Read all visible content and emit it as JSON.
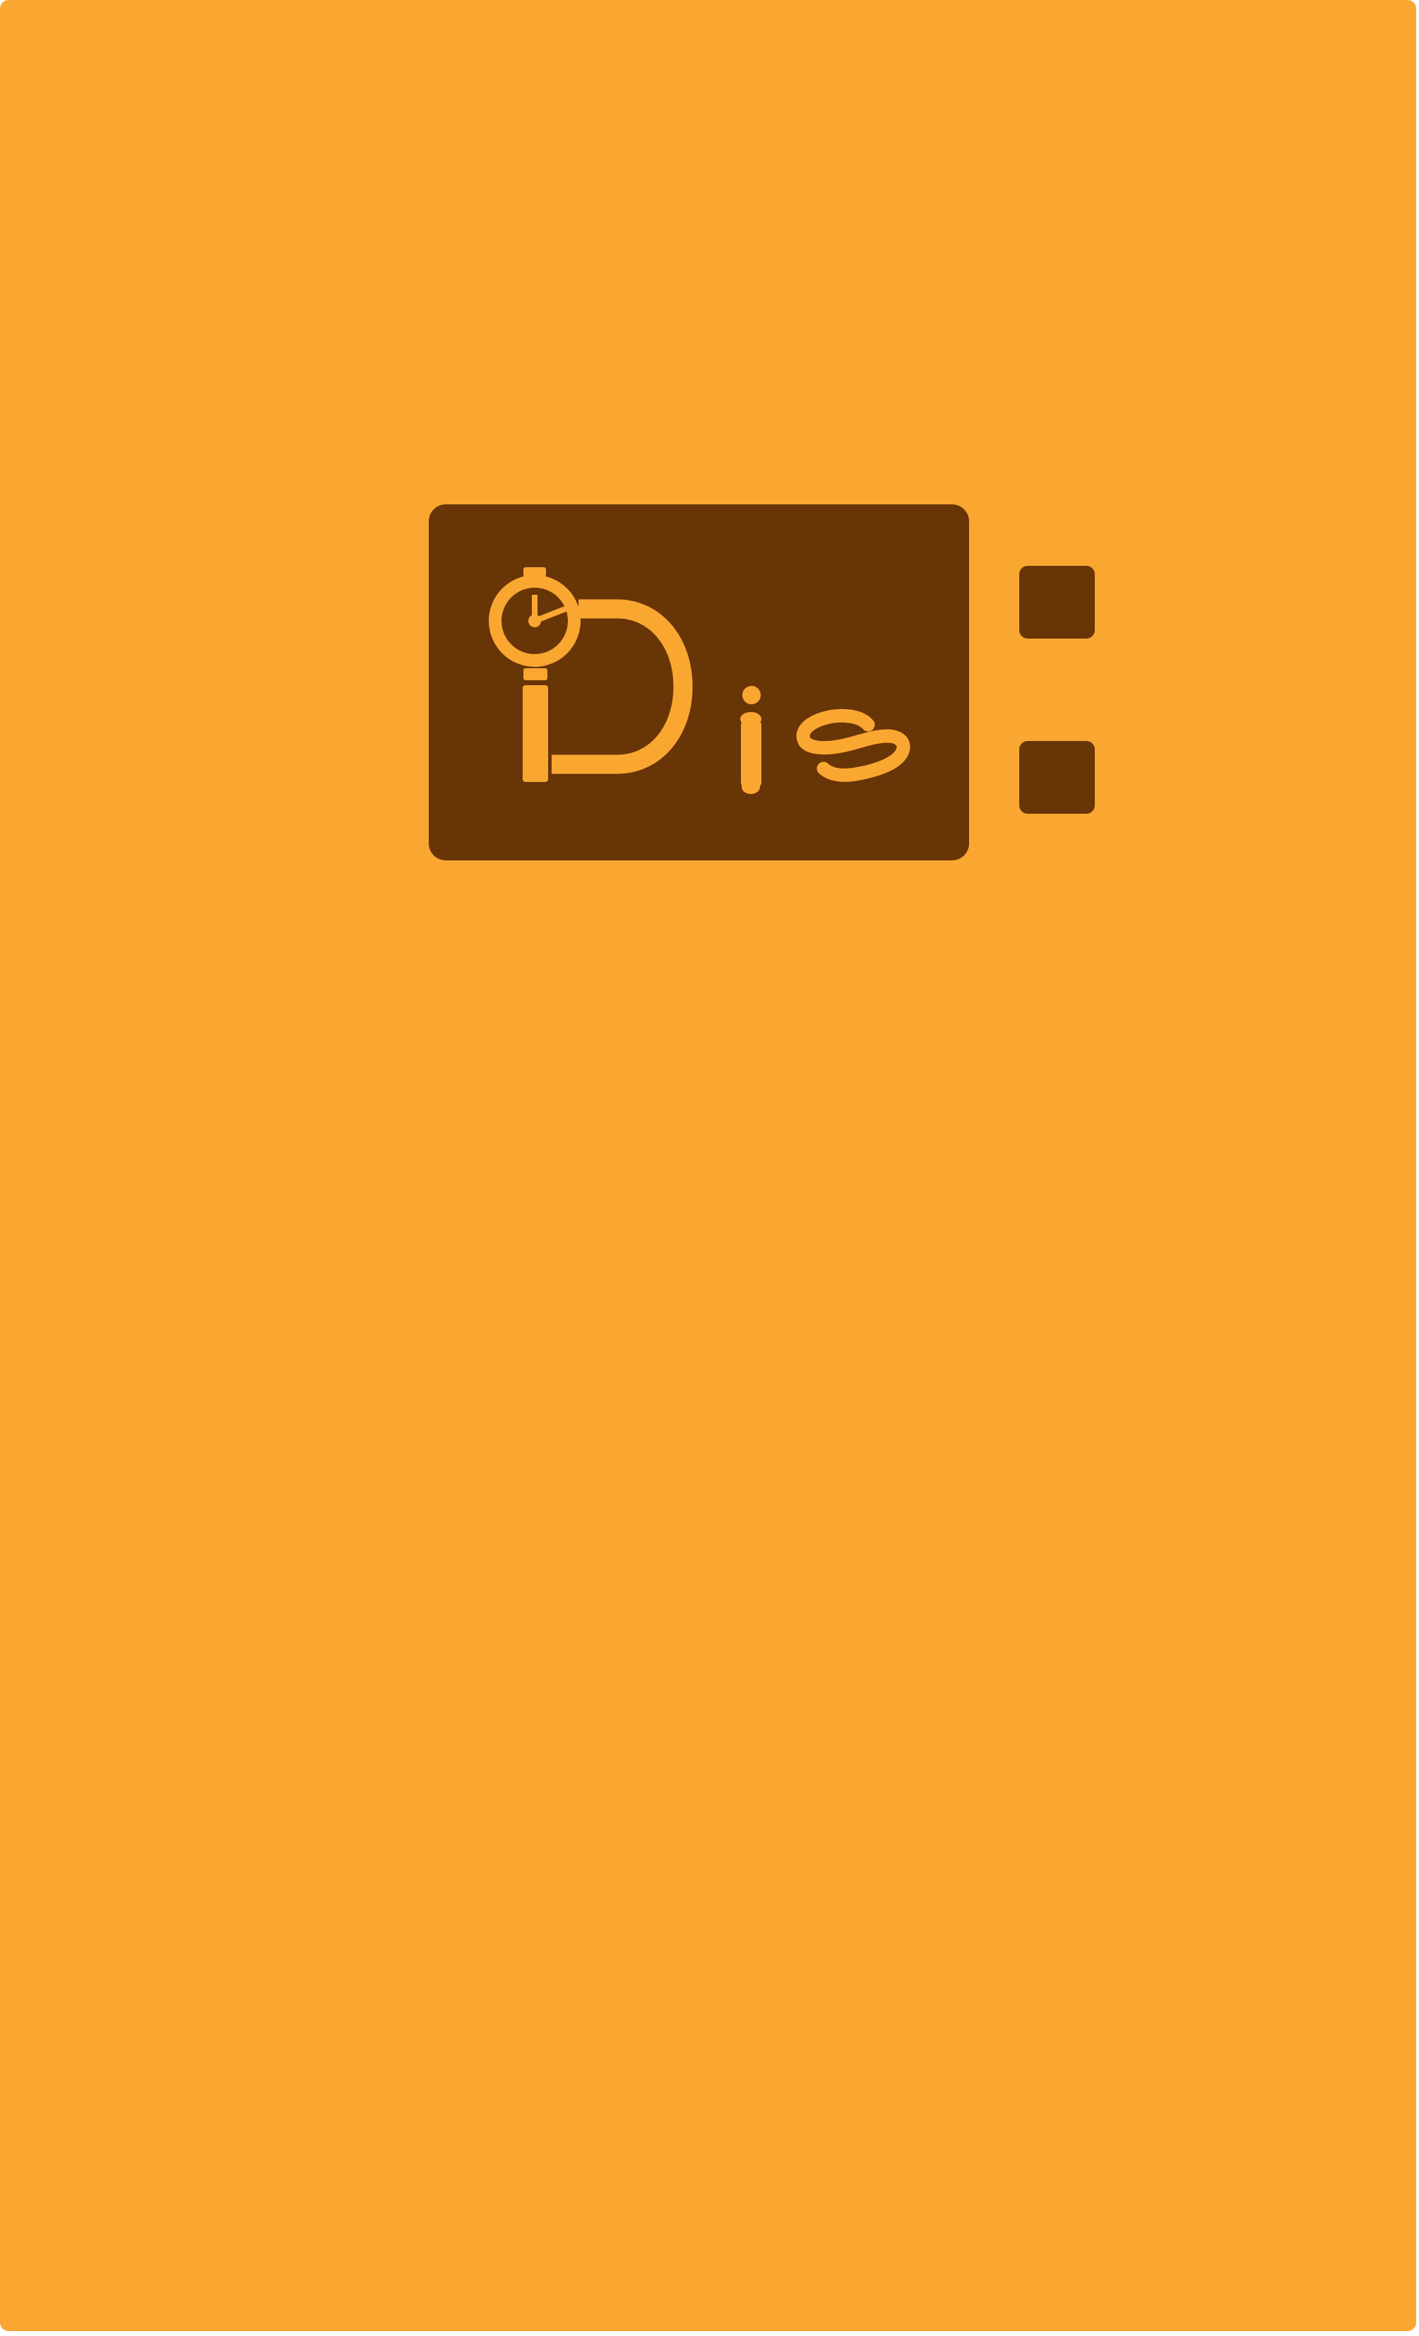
{
  "app": {
    "name": "iDis",
    "logo_initial": "iD",
    "logo_suffix": "is"
  },
  "icons": {
    "logo": "stopwatch-i-logo-icon",
    "stopwatch": "stopwatch-icon",
    "decorative_squares": "square-icon"
  },
  "colors": {
    "background": "#faa732",
    "logo_card": "#683507",
    "accent": "#faa732"
  }
}
